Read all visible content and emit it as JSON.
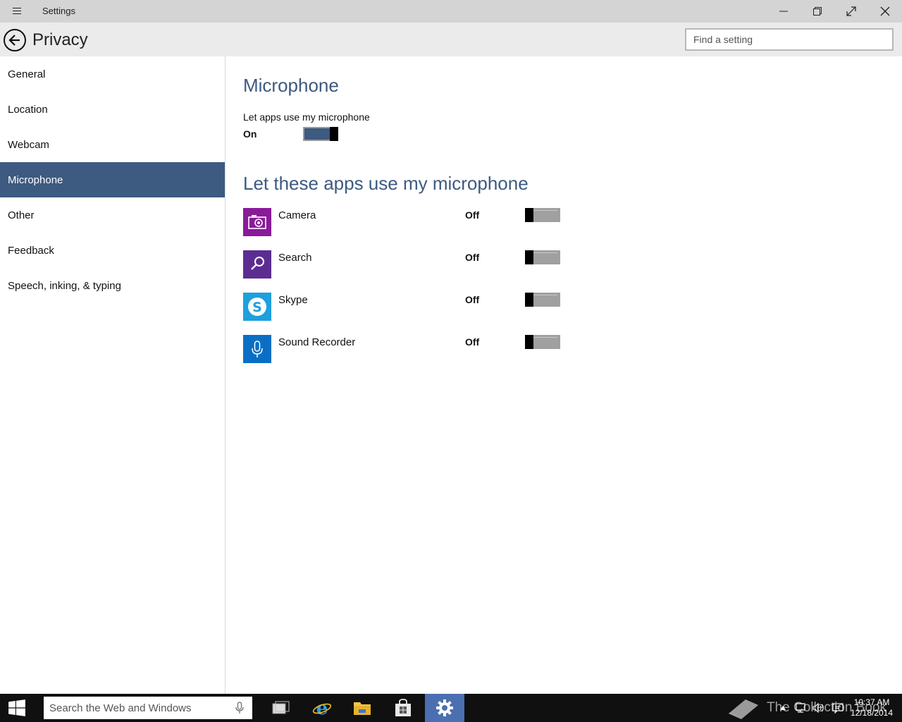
{
  "window": {
    "title": "Settings"
  },
  "header": {
    "title": "Privacy",
    "search_placeholder": "Find a setting"
  },
  "sidebar": {
    "items": [
      {
        "label": "General",
        "active": false
      },
      {
        "label": "Location",
        "active": false
      },
      {
        "label": "Webcam",
        "active": false
      },
      {
        "label": "Microphone",
        "active": true
      },
      {
        "label": "Other",
        "active": false
      },
      {
        "label": "Feedback",
        "active": false
      },
      {
        "label": "Speech, inking, & typing",
        "active": false
      }
    ]
  },
  "main": {
    "title": "Microphone",
    "master_toggle": {
      "label": "Let apps use my microphone",
      "state": "On",
      "on": true
    },
    "apps_title": "Let these apps use my microphone",
    "apps": [
      {
        "name": "Camera",
        "state": "Off",
        "on": false,
        "icon": "camera-icon",
        "color": "#8a1a9a"
      },
      {
        "name": "Search",
        "state": "Off",
        "on": false,
        "icon": "magnifier-icon",
        "color": "#5c2d91"
      },
      {
        "name": "Skype",
        "state": "Off",
        "on": false,
        "icon": "skype-icon",
        "color": "#1ea0dc"
      },
      {
        "name": "Sound Recorder",
        "state": "Off",
        "on": false,
        "icon": "microphone-icon",
        "color": "#0a6fc4"
      }
    ]
  },
  "taskbar": {
    "search_placeholder": "Search the Web and Windows",
    "time": "10:37 AM",
    "date": "12/18/2014",
    "watermark": "The Collection Book"
  },
  "colors": {
    "accent": "#3d5a80",
    "taskbar": "#101010",
    "header": "#ebebeb",
    "titlebar": "#d4d4d4"
  }
}
